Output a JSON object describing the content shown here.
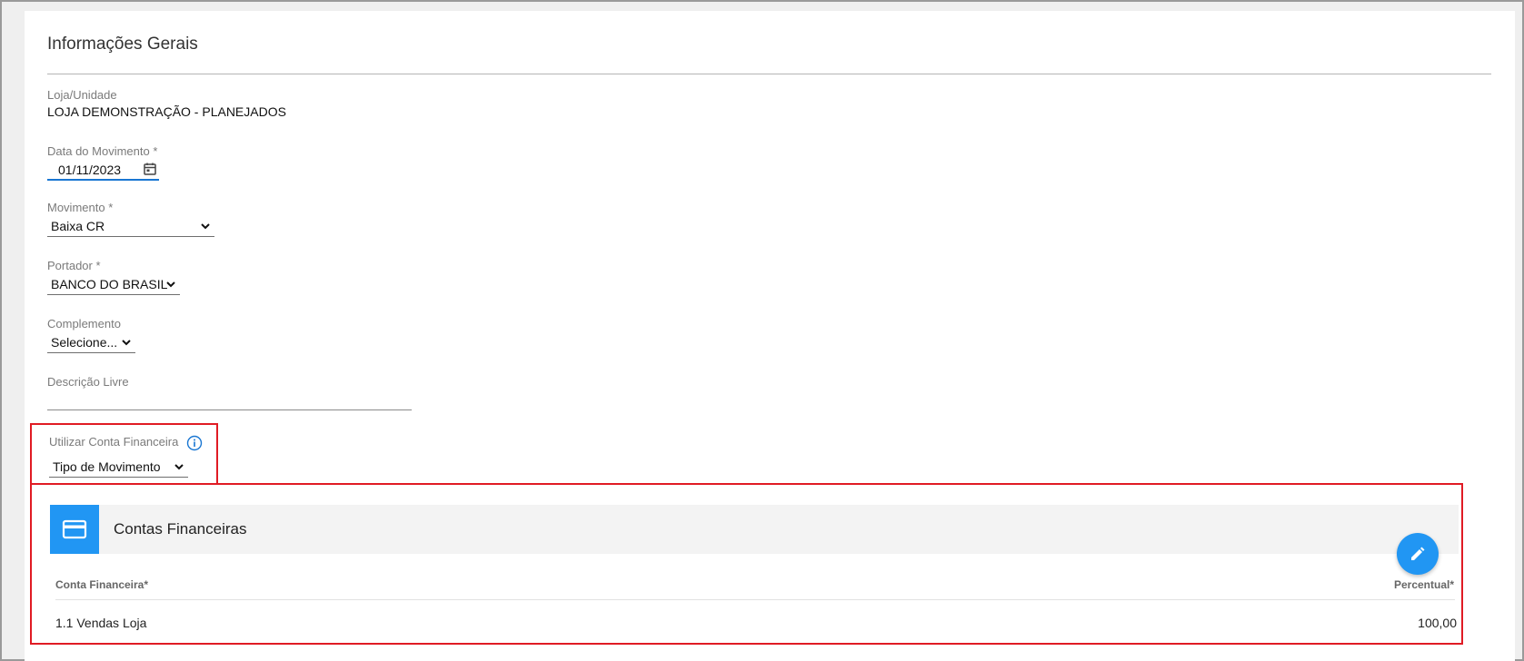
{
  "section": {
    "title": "Informações Gerais"
  },
  "loja": {
    "label": "Loja/Unidade",
    "value": "LOJA DEMONSTRAÇÃO - PLANEJADOS"
  },
  "data_movimento": {
    "label": "Data do Movimento *",
    "value": "01/11/2023"
  },
  "movimento": {
    "label": "Movimento *",
    "selected": "Baixa CR"
  },
  "portador": {
    "label": "Portador *",
    "selected": "BANCO DO BRASIL"
  },
  "complemento": {
    "label": "Complemento",
    "selected": "Selecione..."
  },
  "descricao": {
    "label": "Descrição Livre",
    "value": ""
  },
  "conta_financeira": {
    "label": "Utilizar Conta Financeira",
    "selected": "Tipo de Movimento"
  },
  "contas": {
    "title": "Contas Financeiras",
    "columns": {
      "conta": "Conta Financeira*",
      "percentual": "Percentual*"
    },
    "rows": [
      {
        "conta": "1.1 Vendas Loja",
        "percentual": "100,00"
      }
    ]
  },
  "icons": {
    "calendar": "calendar-icon",
    "chevron": "chevron-down-icon",
    "info": "info-icon",
    "card": "credit-card-icon",
    "edit": "pencil-icon"
  },
  "colors": {
    "accent": "#2196f3",
    "highlight": "#e01b24",
    "focus_underline": "#1976d2"
  }
}
